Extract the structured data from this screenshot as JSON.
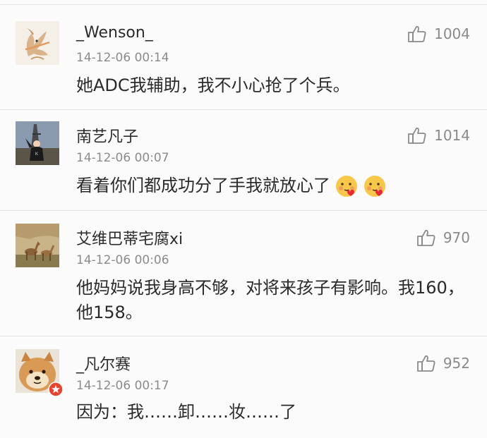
{
  "comments": [
    {
      "username": "_Wenson_",
      "time": "14-12-06 00:14",
      "text": "她ADC我辅助，我不小心抢了个兵。",
      "likes": "1004",
      "avatar": "fox-illustration-avatar"
    },
    {
      "username": "南艺凡子",
      "time": "14-12-06 00:07",
      "text": "看着你们都成功分了手我就放心了",
      "likes": "1014",
      "avatar": "eiffel-tower-photo-avatar",
      "emojis": [
        "kiss-emoji",
        "kiss-emoji"
      ]
    },
    {
      "username": "艾维巴蒂宅腐xi",
      "time": "14-12-06 00:06",
      "text": "他妈妈说我身高不够，对将来孩子有影响。我160，他158。",
      "likes": "970",
      "avatar": "deer-photo-avatar"
    },
    {
      "username": "_凡尔赛",
      "time": "14-12-06 00:17",
      "text": "因为：我……卸……妆……了",
      "likes": "952",
      "avatar": "shiba-dog-photo-avatar"
    }
  ],
  "icons": {
    "like": "thumbs-up-icon",
    "badge": "verified-badge-icon"
  },
  "colors": {
    "background": "#fbfbfb",
    "username": "#2b2b2b",
    "meta": "#8b8b8b",
    "badge": "#e8432e"
  }
}
